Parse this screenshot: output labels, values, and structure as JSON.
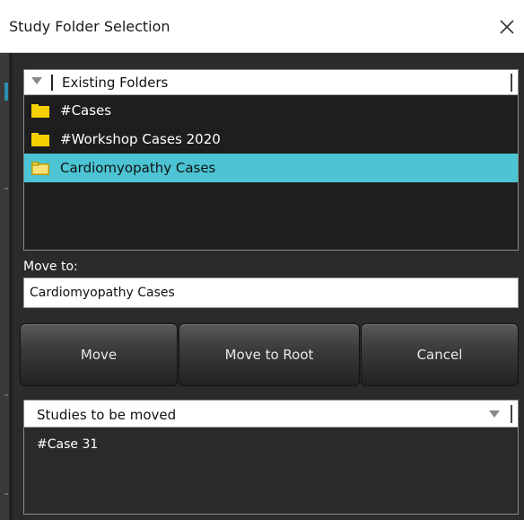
{
  "window": {
    "title": "Study Folder Selection",
    "close_icon": "close-icon"
  },
  "colors": {
    "panel_bg": "#2b2b2b",
    "selection": "#4cc4d4",
    "folder_yellow": "#f5d000"
  },
  "folders": {
    "header_label": "Existing Folders",
    "items": [
      {
        "name": "#Cases",
        "icon": "folder-icon",
        "selected": false
      },
      {
        "name": "#Workshop Cases 2020",
        "icon": "folder-icon",
        "selected": false
      },
      {
        "name": "Cardiomyopathy Cases",
        "icon": "folder-open-icon",
        "selected": true
      }
    ]
  },
  "move_to": {
    "label": "Move to:",
    "value": "Cardiomyopathy Cases"
  },
  "buttons": {
    "move": "Move",
    "move_to_root": "Move to Root",
    "cancel": "Cancel"
  },
  "studies": {
    "header_label": "Studies to be moved",
    "items": [
      "#Case 31"
    ]
  }
}
